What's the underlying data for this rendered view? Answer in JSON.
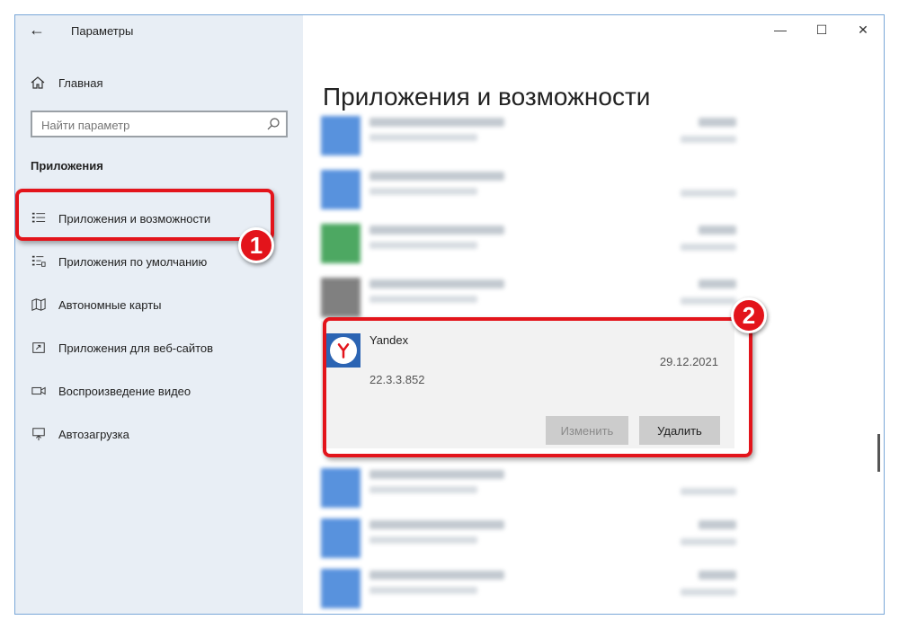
{
  "window": {
    "title": "Параметры"
  },
  "sidebar": {
    "home_label": "Главная",
    "search_placeholder": "Найти параметр",
    "section_title": "Приложения",
    "items": [
      {
        "label": "Приложения и возможности",
        "icon": "apps-features-icon"
      },
      {
        "label": "Приложения по умолчанию",
        "icon": "default-apps-icon"
      },
      {
        "label": "Автономные карты",
        "icon": "offline-maps-icon"
      },
      {
        "label": "Приложения для веб-сайтов",
        "icon": "apps-for-websites-icon"
      },
      {
        "label": "Воспроизведение видео",
        "icon": "video-playback-icon"
      },
      {
        "label": "Автозагрузка",
        "icon": "startup-icon"
      }
    ]
  },
  "main": {
    "title": "Приложения и возможности",
    "selected_app": {
      "name": "Yandex",
      "version": "22.3.3.852",
      "date": "29.12.2021",
      "modify_label": "Изменить",
      "uninstall_label": "Удалить"
    },
    "blurred_app_colors": [
      "#3b7fd8",
      "#3b7fd8",
      "#2e9a47",
      "#6b6b6b",
      "#3b7fd8",
      "#3b7fd8",
      "#3b7fd8"
    ]
  },
  "annotations": {
    "badge1": "1",
    "badge2": "2"
  },
  "colors": {
    "accent": "#e3141b",
    "sidebar_bg": "#e8eef5",
    "selected_bg": "#f2f2f2",
    "yandex_tile": "#2b64b3"
  }
}
